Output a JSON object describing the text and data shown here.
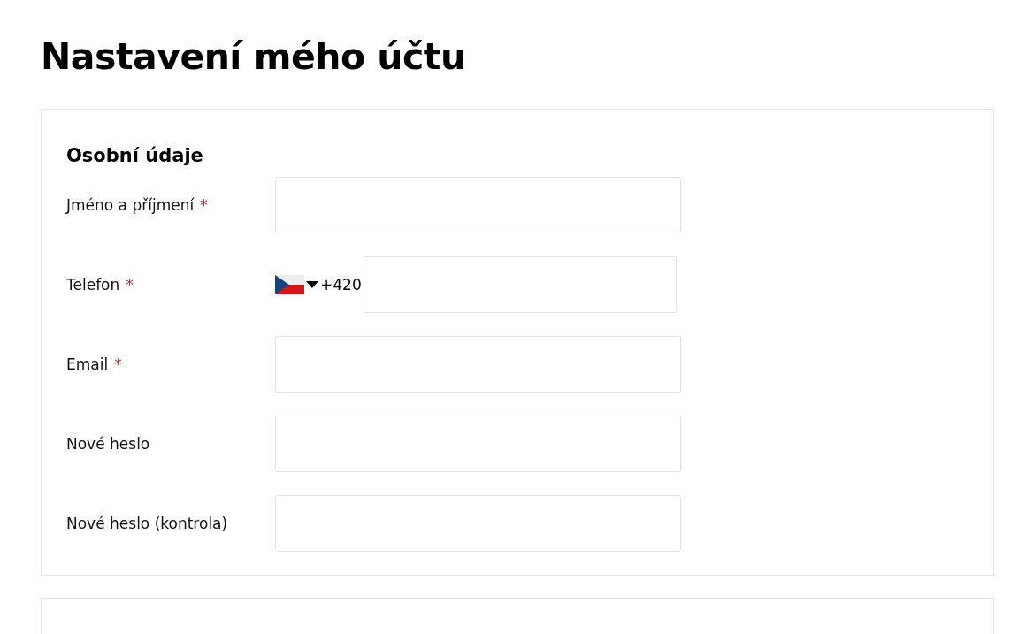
{
  "page_title": "Nastavení mého účtu",
  "sections": [
    {
      "title": "Osobní údaje",
      "fields": [
        {
          "kind": "text",
          "label": "Jméno a příjmení",
          "required_mark": "*"
        },
        {
          "kind": "phone",
          "label": "Telefon",
          "required_mark": "*",
          "dial_code": "+420"
        },
        {
          "kind": "text",
          "label": "Email",
          "required_mark": "*"
        },
        {
          "kind": "password",
          "label": "Nové heslo"
        },
        {
          "kind": "password",
          "label": "Nové heslo (kontrola)"
        }
      ]
    }
  ]
}
